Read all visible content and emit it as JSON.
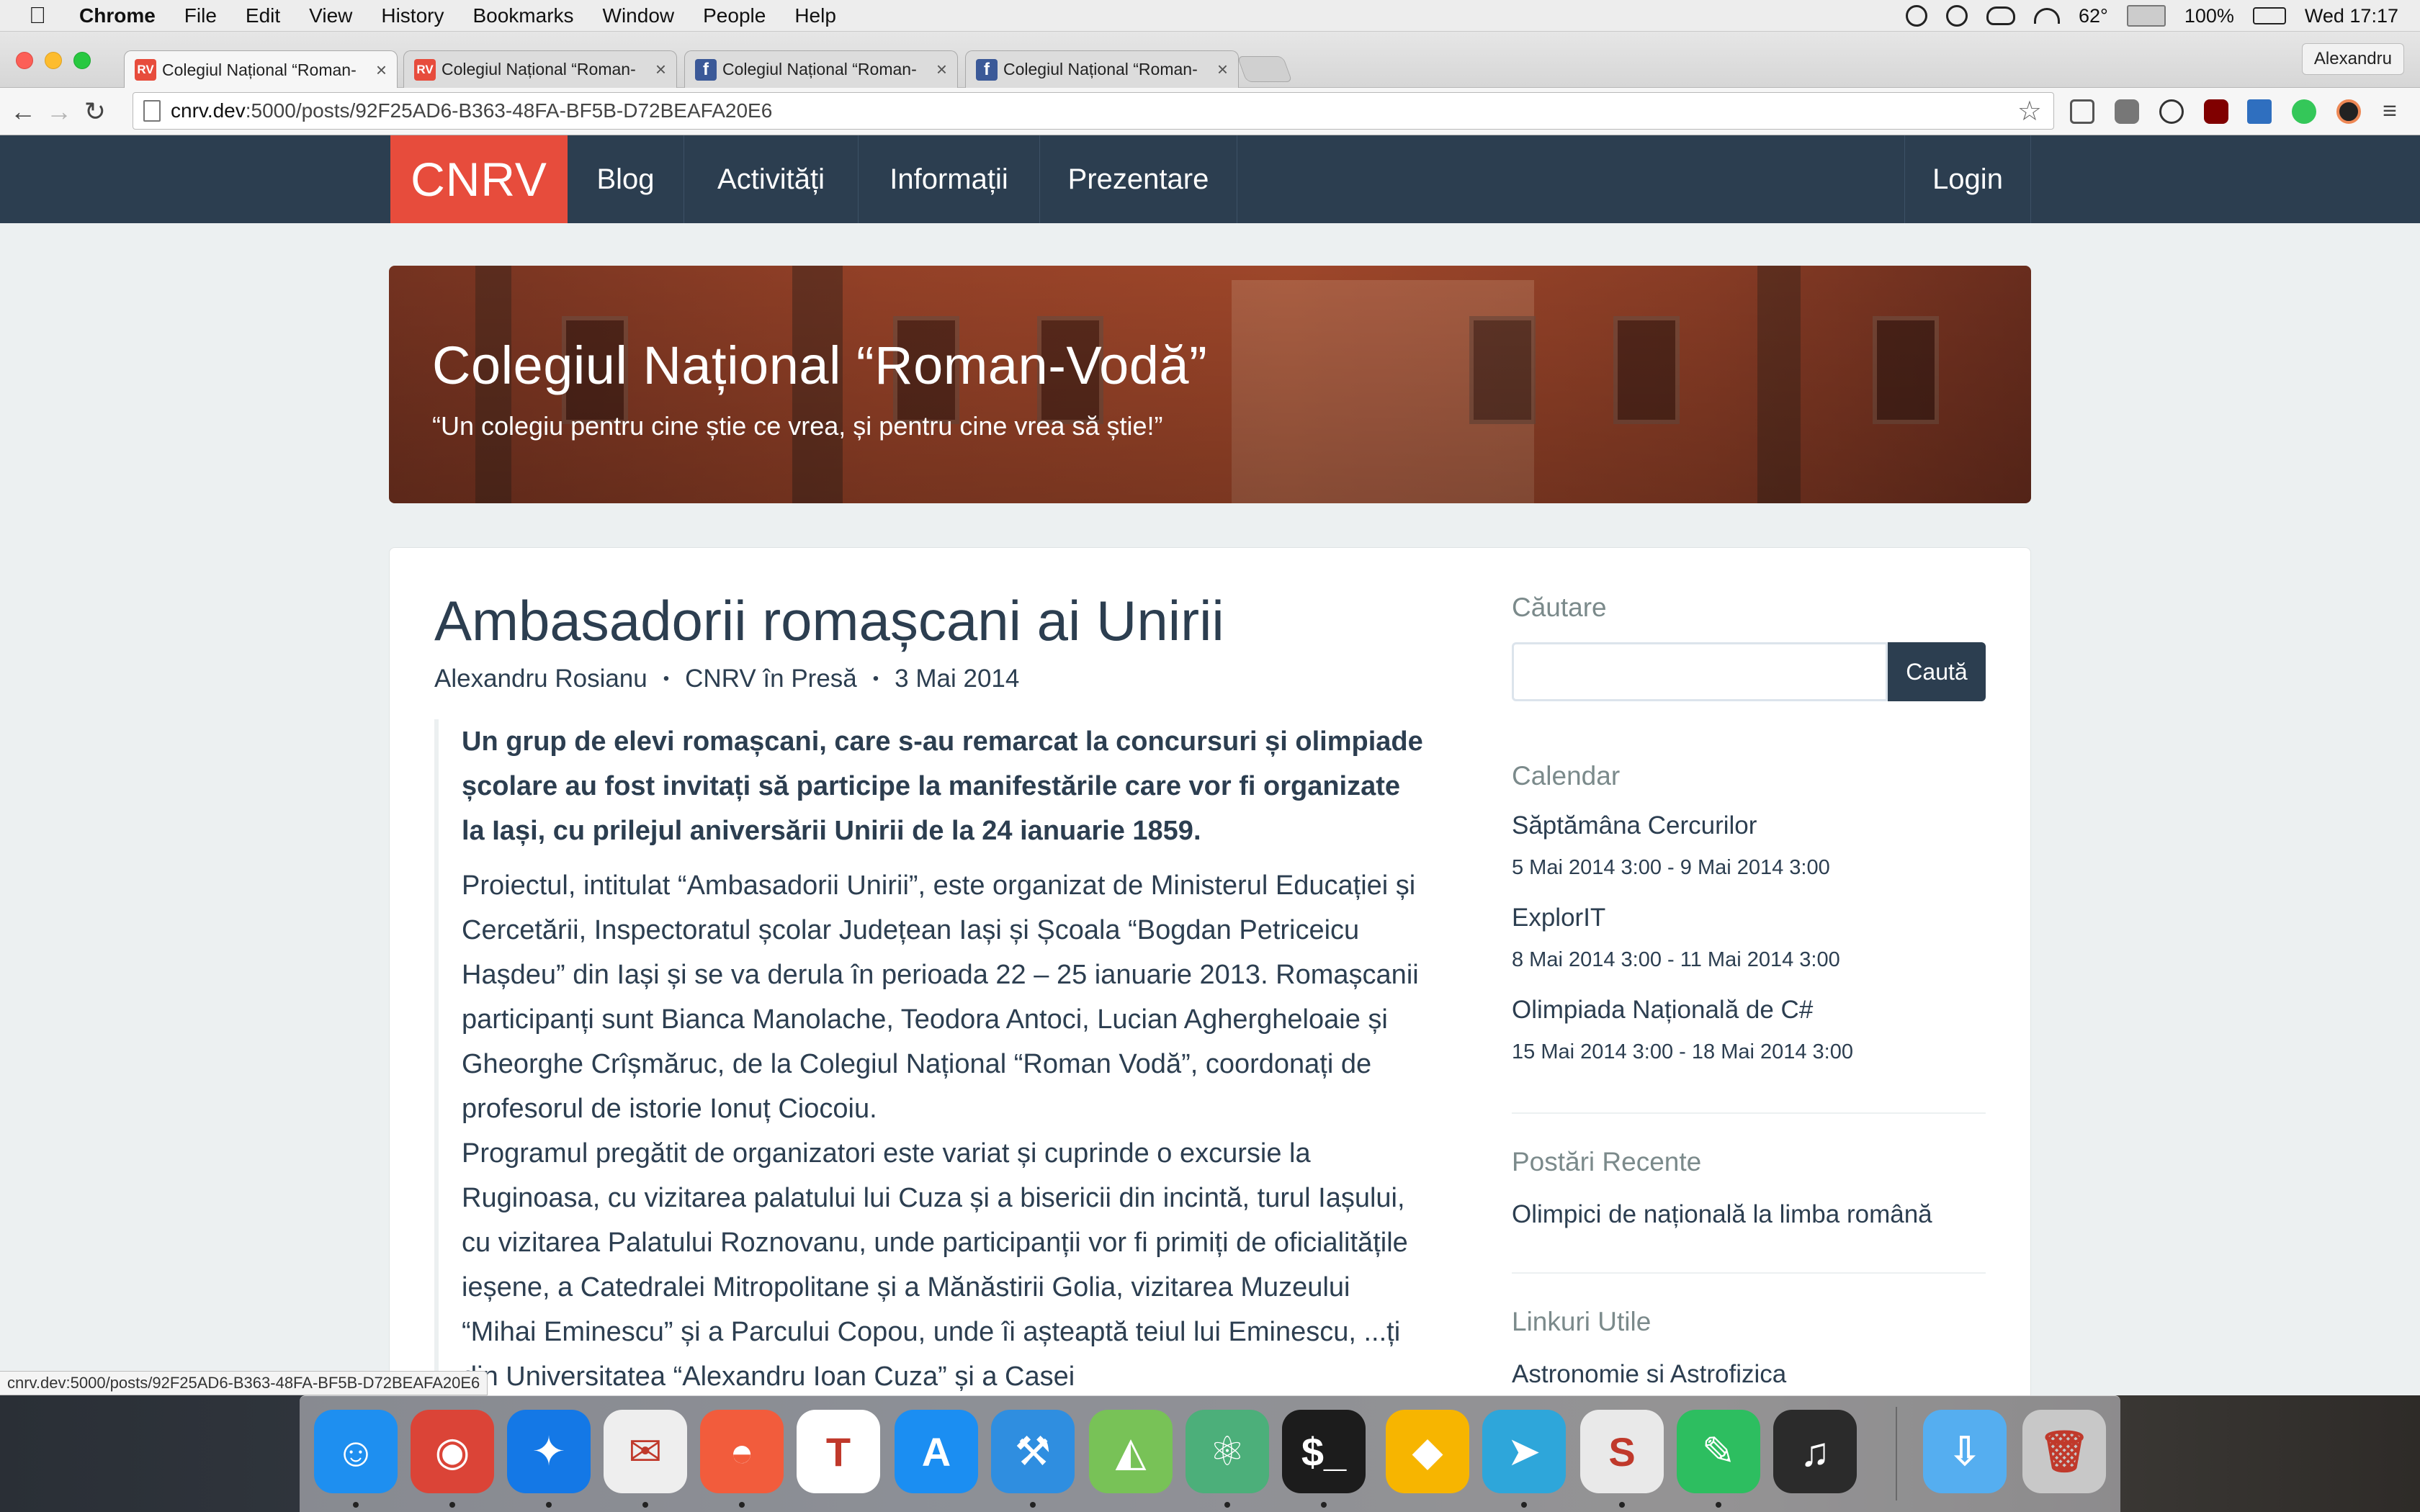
{
  "menubar": {
    "app": "Chrome",
    "items": [
      "File",
      "Edit",
      "View",
      "History",
      "Bookmarks",
      "Window",
      "People",
      "Help"
    ],
    "temperature": "62°",
    "battery": "100%",
    "clock": "Wed 17:17"
  },
  "tabs": [
    {
      "title": "Colegiul Național “Roman-",
      "favicon": "RV",
      "active": true
    },
    {
      "title": "Colegiul Național “Roman-",
      "favicon": "RV",
      "active": false
    },
    {
      "title": "Colegiul Național “Roman-",
      "favicon": "f",
      "active": false
    },
    {
      "title": "Colegiul Național “Roman-",
      "favicon": "f",
      "active": false
    }
  ],
  "tab_close_glyph": "×",
  "profile": "Alexandru",
  "omnibox": {
    "host": "cnrv.dev",
    "path": ":5000/posts/92F25AD6-B363-48FA-BF5B-D72BEAFA20E6"
  },
  "site_nav": {
    "brand": "CNRV",
    "links": [
      "Blog",
      "Activități",
      "Informații",
      "Prezentare"
    ],
    "login": "Login"
  },
  "hero": {
    "title": "Colegiul Național “Roman-Vodă”",
    "motto": "“Un colegiu pentru cine știe ce vrea, și pentru cine vrea să știe!”"
  },
  "post": {
    "title": "Ambasadorii romașcani ai Unirii",
    "author": "Alexandru Rosianu",
    "category": "CNRV în Presă",
    "date": "3 Mai 2014",
    "meta_separator": "•",
    "lead": "Un grup de elevi romașcani, care s-au remarcat la concursuri și olimpiade școlare au fost invitați să participe  la manifestările care vor fi organizate la Iași, cu prilejul aniversării Unirii de la 24 ianuarie 1859.",
    "paragraph1": "Proiectul, intitulat “Ambasadorii Unirii”, este organizat de Ministerul Educației și Cercetării, Inspectoratul școlar Județean Iași și Școala “Bogdan Petriceicu Hașdeu” din Iași și se va derula în perioada 22 – 25 ianuarie 2013. Romașcanii participanți sunt Bianca Manolache, Teodora Antoci, Lucian Aghergheloaie și Gheorghe Crîșmăruc, de la Colegiul Național “Roman Vodă”, coordonați de profesorul de istorie Ionuț Ciocoiu.",
    "paragraph2": "Programul pregătit de organizatori este variat și cuprinde o excursie la Ruginoasa, cu vizitarea palatului lui Cuza și a bisericii din incintă, turul Iașului, cu vizitarea Palatului Roznovanu, unde participanții vor fi primiți de oficialitățile ieșene, a Catedralei Mitropolitane și a Mănăstirii Golia, vizitarea Muzeului “Mihai Eminescu” și a Parcului Copou, unde îi așteaptă teiul lui Eminescu, ...ți din Universitatea “Alexandru Ioan Cuza” și a Casei"
  },
  "sidebar": {
    "search_heading": "Căutare",
    "search_button": "Caută",
    "search_value": "",
    "calendar_heading": "Calendar",
    "events": [
      {
        "title": "Săptămâna Cercurilor",
        "dates": "5 Mai 2014 3:00 - 9 Mai 2014 3:00"
      },
      {
        "title": "ExplorIT",
        "dates": "8 Mai 2014 3:00 - 11 Mai 2014 3:00"
      },
      {
        "title": "Olimpiada Națională de C#",
        "dates": "15 Mai 2014 3:00 - 18 Mai 2014 3:00"
      }
    ],
    "recent_heading": "Postări Recente",
    "recent": [
      "Olimpici de națională la limba română"
    ],
    "links_heading": "Linkuri Utile",
    "links": [
      "Astronomie si Astrofizica"
    ]
  },
  "statusbar": "cnrv.dev:5000/posts/92F25AD6-B363-48FA-BF5B-D72BEAFA20E6",
  "colors": {
    "navbar": "#2c3e50",
    "brand": "#e74c3c",
    "text": "#2c3e50",
    "muted": "#7b8a8b",
    "page_bg": "#ecf0f1"
  },
  "dock": [
    {
      "name": "finder",
      "glyph": "☺",
      "color": "#1e8ff0"
    },
    {
      "name": "chrome",
      "glyph": "◉",
      "color": "#db4437"
    },
    {
      "name": "safari",
      "glyph": "✦",
      "color": "#1478e6"
    },
    {
      "name": "mail",
      "glyph": "✉",
      "color": "#eeeeee"
    },
    {
      "name": "sunrise",
      "glyph": "◓",
      "color": "#f25c3c"
    },
    {
      "name": "todoist",
      "glyph": "T",
      "color": "#ffffff"
    },
    {
      "name": "app-store",
      "glyph": "A",
      "color": "#1b8ef2"
    },
    {
      "name": "xcode",
      "glyph": "⚒",
      "color": "#2f8ee0"
    },
    {
      "name": "android-studio",
      "glyph": "◭",
      "color": "#78c257"
    },
    {
      "name": "atom",
      "glyph": "⚛",
      "color": "#4caf7a"
    },
    {
      "name": "terminal",
      "glyph": "$_",
      "color": "#1c1c1c"
    },
    {
      "name": "sketch",
      "glyph": "◆",
      "color": "#f7b500"
    },
    {
      "name": "telegram",
      "glyph": "➤",
      "color": "#2ea6da"
    },
    {
      "name": "slack",
      "glyph": "S",
      "color": "#e9e9e9"
    },
    {
      "name": "evernote",
      "glyph": "✎",
      "color": "#2dbe60"
    },
    {
      "name": "music",
      "glyph": "♫",
      "color": "#2b2b2b"
    },
    {
      "name": "downloads",
      "glyph": "⇩",
      "color": "#55aef0"
    },
    {
      "name": "trash",
      "glyph": "🗑",
      "color": "#c8c8c8"
    }
  ]
}
